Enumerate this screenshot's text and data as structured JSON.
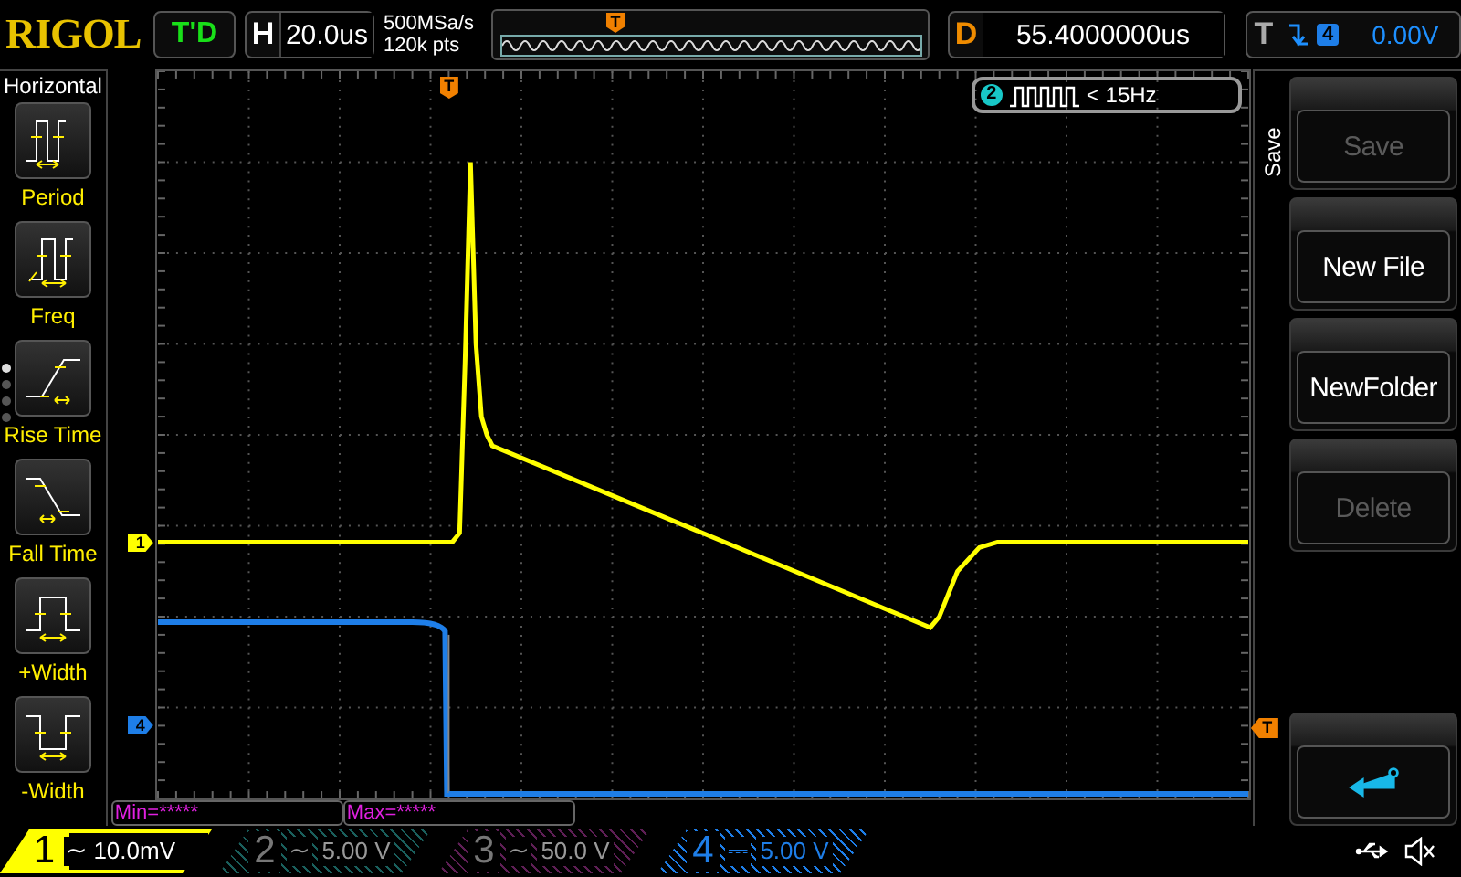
{
  "top_bar": {
    "logo": "RIGOL",
    "run_status": "T'D",
    "timebase": {
      "label": "H",
      "value": "20.0us"
    },
    "acquisition": {
      "sample_rate": "500MSa/s",
      "memory_depth": "120k pts"
    },
    "delay": {
      "label": "D",
      "value": "55.4000000us"
    },
    "trigger": {
      "label": "T",
      "source": "4",
      "level": "0.00V"
    },
    "overview_marker": "T"
  },
  "measure_menu": {
    "title": "Horizontal",
    "items": [
      {
        "kind": "period",
        "label": "Period"
      },
      {
        "kind": "freq",
        "label": "Freq"
      },
      {
        "kind": "rise",
        "label": "Rise Time"
      },
      {
        "kind": "fall",
        "label": "Fall Time"
      },
      {
        "kind": "pwidth",
        "label": "+Width"
      },
      {
        "kind": "nwidth",
        "label": "-Width"
      }
    ],
    "pages": [
      {
        "selected": true
      },
      {
        "selected": false
      },
      {
        "selected": false
      },
      {
        "selected": false
      }
    ]
  },
  "screen": {
    "channel_markers": [
      {
        "label": "1",
        "color": "#ffff00"
      },
      {
        "label": "4",
        "color": "#1e7ee8"
      }
    ],
    "trigger_markers": [
      "T",
      "T"
    ],
    "counter": {
      "channel": "2",
      "reading": "< 15Hz"
    },
    "statistics": [
      "Min=*****",
      "Max=*****"
    ]
  },
  "soft_menu": {
    "title": "Save",
    "buttons": [
      {
        "kind": "text",
        "label": "Save",
        "disabled": true
      },
      {
        "kind": "text",
        "label": "New File",
        "disabled": false
      },
      {
        "kind": "text",
        "label": "NewFolder",
        "disabled": false
      },
      {
        "kind": "text",
        "label": "Delete",
        "disabled": true
      },
      {
        "kind": "spacer"
      },
      {
        "kind": "back"
      }
    ]
  },
  "channels": [
    {
      "number": "1",
      "coupling": "~",
      "scale": "10.0mV",
      "color": "#ffff00",
      "selected": true,
      "on": true
    },
    {
      "number": "2",
      "coupling": "~",
      "scale": "5.00 V",
      "color": "#1a5f5c",
      "selected": false,
      "on": false
    },
    {
      "number": "3",
      "coupling": "~",
      "scale": "50.0 V",
      "color": "#5e1f55",
      "selected": false,
      "on": false
    },
    {
      "number": "4",
      "coupling": "⎓",
      "scale": "5.00 V",
      "color": "#1e7ee8",
      "selected": false,
      "on": true
    }
  ]
}
